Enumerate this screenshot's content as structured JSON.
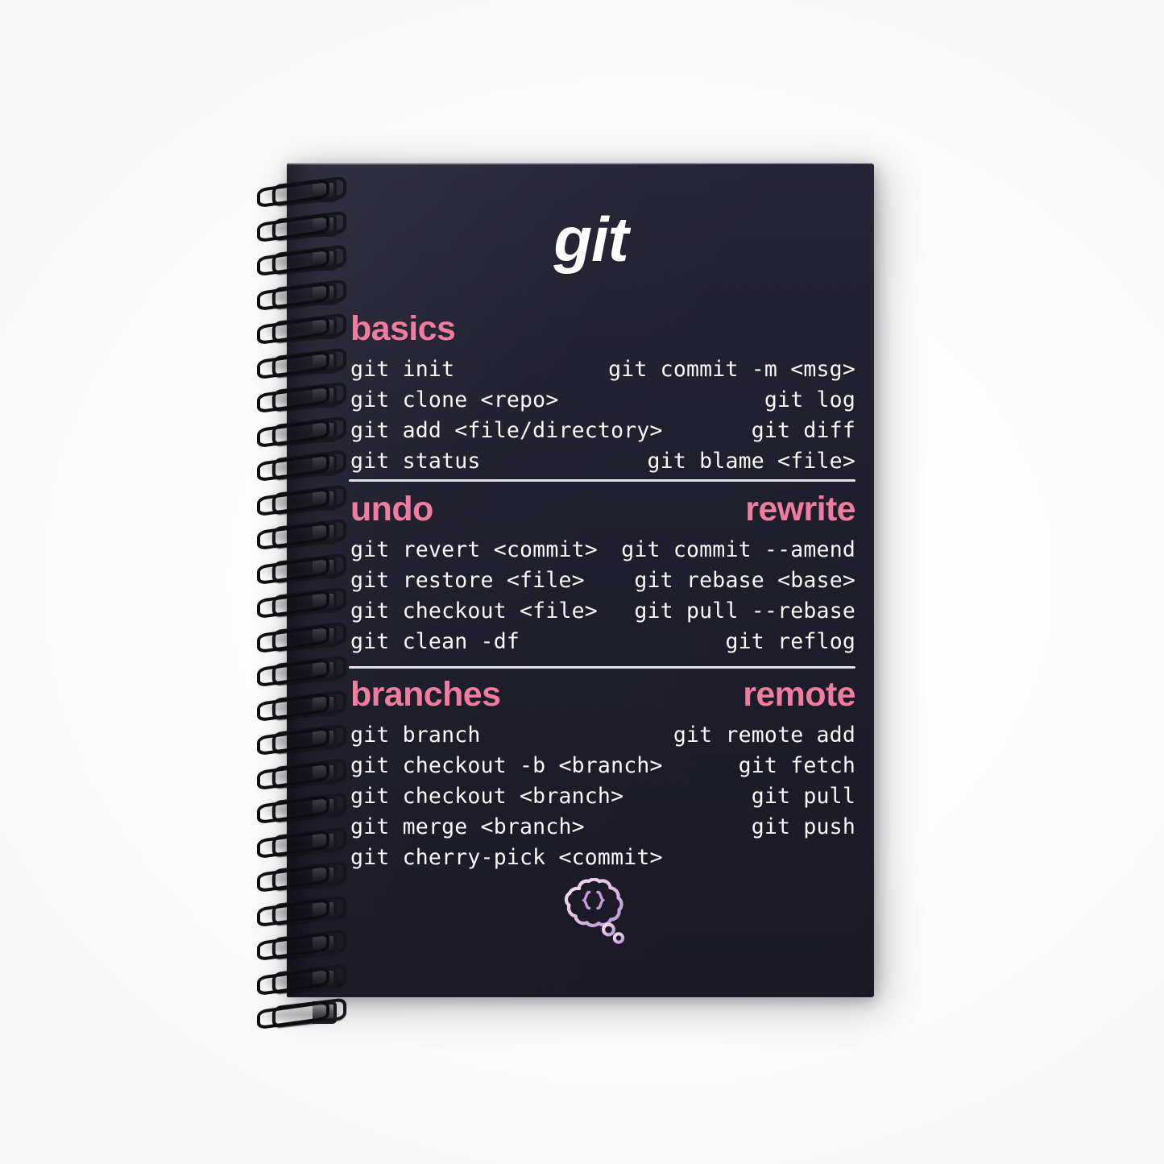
{
  "product": {
    "type": "spiral-notebook",
    "cover_color": "#1e1d2a",
    "accent_color": "#ef7d9f",
    "text_color": "#fbfbfc"
  },
  "cover": {
    "brand_title": "git",
    "logo": {
      "name": "thought-bubble-braces-logo",
      "glyph": "{}",
      "gradient_from": "#f3d9ef",
      "gradient_to": "#b79ad8"
    },
    "sections": [
      {
        "id": "basics",
        "heading_left": "basics",
        "heading_right": "",
        "rows": [
          {
            "left": "git init",
            "right": "git commit -m <msg>"
          },
          {
            "left": "git clone <repo>",
            "right": "git log"
          },
          {
            "left": "git add <file/directory>",
            "right": "git diff"
          },
          {
            "left": "git status",
            "right": "git blame <file>"
          }
        ]
      },
      {
        "id": "undo",
        "heading_left": "undo",
        "heading_right": "rewrite",
        "rows": [
          {
            "left": "git revert <commit>",
            "right": "git commit --amend"
          },
          {
            "left": "git restore <file>",
            "right": "git rebase <base>"
          },
          {
            "left": "git checkout <file>",
            "right": "git pull --rebase"
          },
          {
            "left": "git clean -df",
            "right": "git reflog"
          }
        ]
      },
      {
        "id": "branches",
        "heading_left": "branches",
        "heading_right": "remote",
        "rows": [
          {
            "left": "git branch",
            "right": "git remote add"
          },
          {
            "left": "git checkout -b <branch>",
            "right": "git fetch"
          },
          {
            "left": "git checkout <branch>",
            "right": "git pull"
          },
          {
            "left": "git merge <branch>",
            "right": "git push"
          },
          {
            "left": "git cherry-pick <commit>",
            "right": ""
          }
        ]
      }
    ]
  }
}
